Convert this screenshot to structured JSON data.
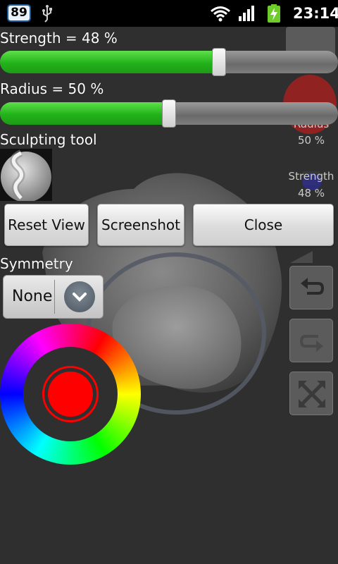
{
  "status_bar": {
    "notification_count": "89",
    "time": "23:14",
    "icons": [
      "notification-badge-icon",
      "usb-icon",
      "wifi-icon",
      "signal-icon",
      "battery-charging-icon"
    ]
  },
  "controls": {
    "strength_label": "Strength = 48 %",
    "strength_value": 48,
    "radius_label": "Radius = 50 %",
    "radius_value": 50,
    "sculpt_tool_label": "Sculpting tool",
    "symmetry_label": "Symmetry",
    "symmetry_selected": "None"
  },
  "buttons": {
    "reset_view": "Reset View",
    "screenshot": "Screenshot",
    "close": "Close"
  },
  "side_panel": {
    "radius_label": "Radius",
    "radius_value": "50 %",
    "strength_label": "Strength",
    "strength_value": "48 %",
    "tool_icons": [
      "undo-icon",
      "redo-icon",
      "fullscreen-icon"
    ]
  },
  "color_picker": {
    "selected_color": "#ff0000"
  },
  "colors": {
    "slider_green": "#22b21a",
    "background": "#2f2f2f"
  }
}
